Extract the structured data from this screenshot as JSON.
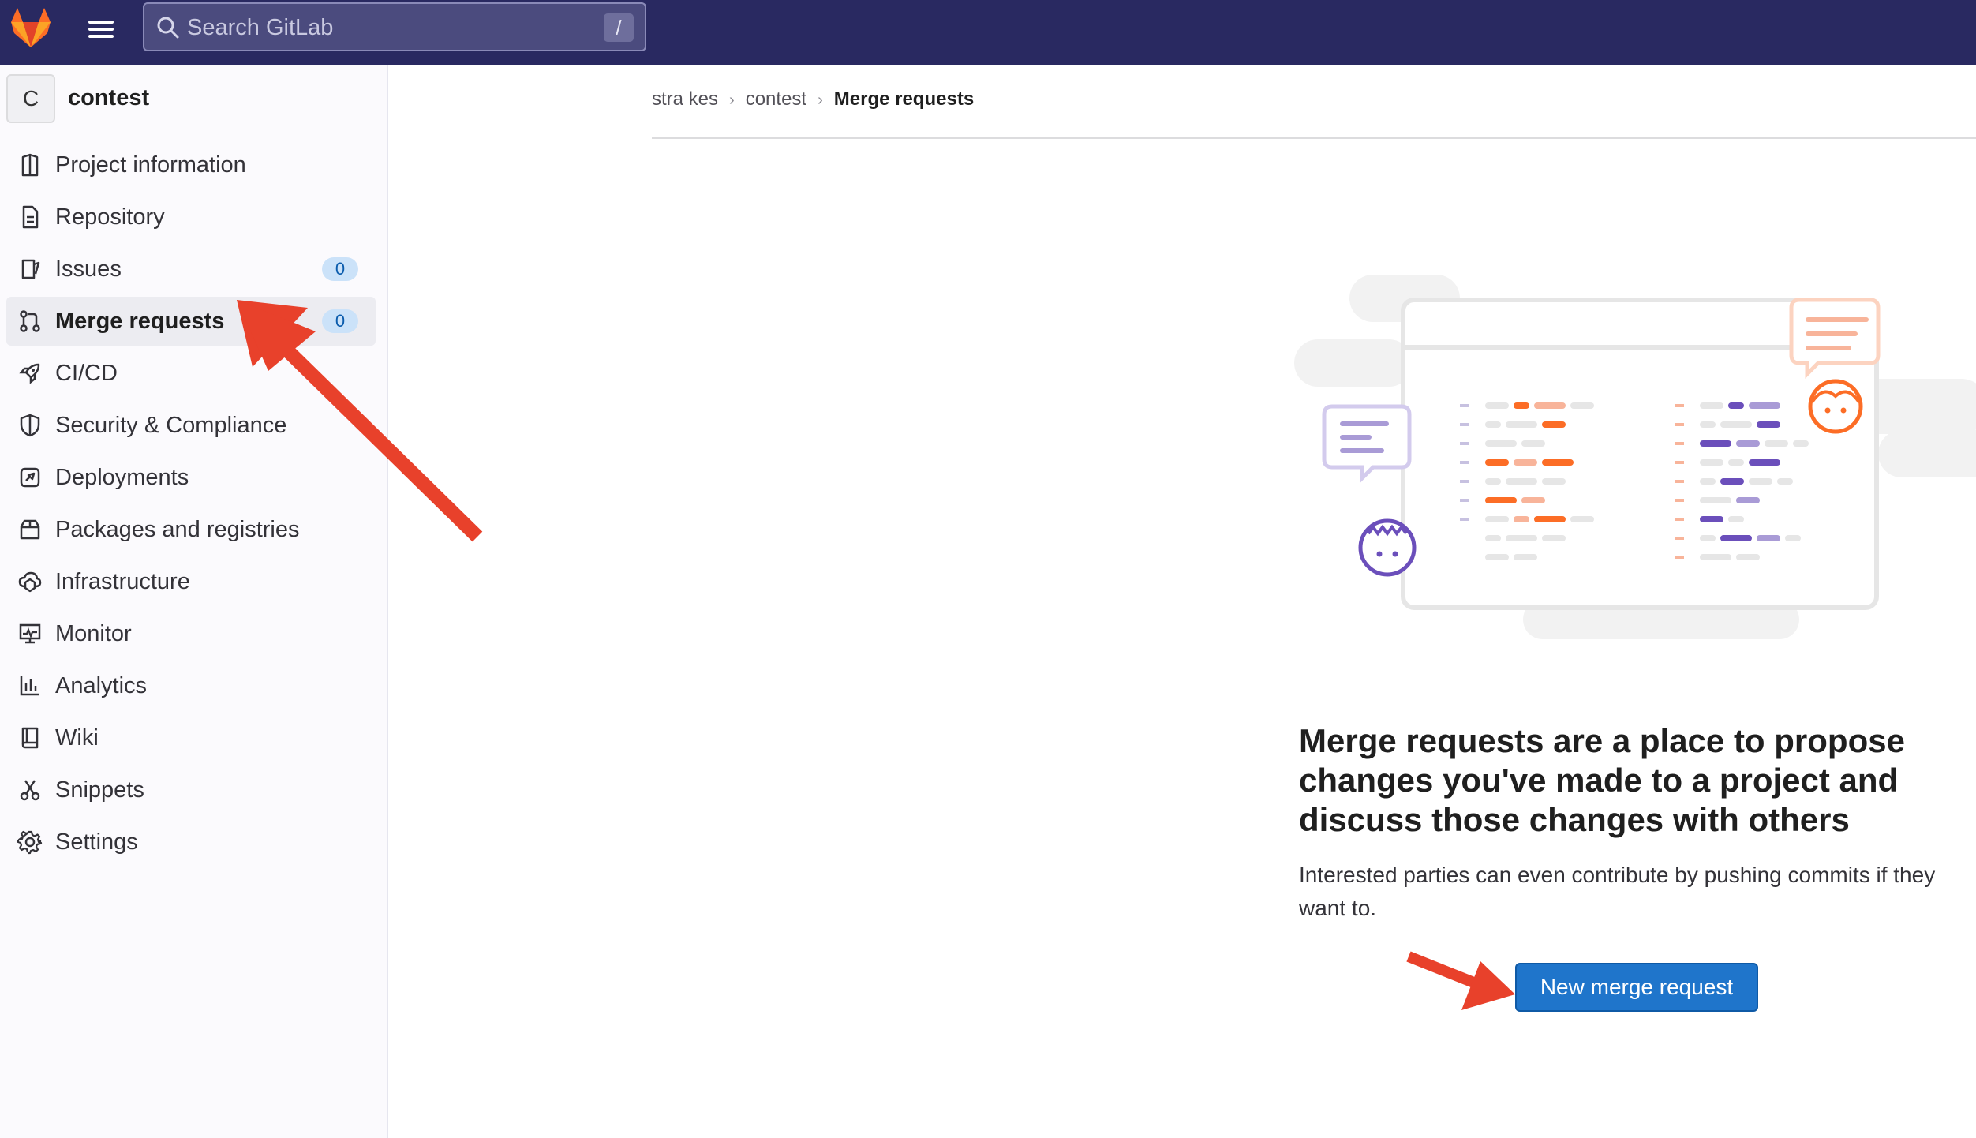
{
  "topbar": {
    "search_placeholder": "Search GitLab",
    "search_shortcut": "/",
    "colors": {
      "background": "#292961",
      "logo": "#e24329"
    }
  },
  "project": {
    "avatar_letter": "C",
    "name": "contest"
  },
  "sidebar": {
    "items": [
      {
        "label": "Project information",
        "icon": "project-information-icon"
      },
      {
        "label": "Repository",
        "icon": "repository-icon"
      },
      {
        "label": "Issues",
        "icon": "issues-icon",
        "badge": "0"
      },
      {
        "label": "Merge requests",
        "icon": "merge-request-icon",
        "badge": "0",
        "active": true
      },
      {
        "label": "CI/CD",
        "icon": "rocket-icon"
      },
      {
        "label": "Security & Compliance",
        "icon": "shield-icon"
      },
      {
        "label": "Deployments",
        "icon": "deployments-icon"
      },
      {
        "label": "Packages and registries",
        "icon": "package-icon"
      },
      {
        "label": "Infrastructure",
        "icon": "infrastructure-icon"
      },
      {
        "label": "Monitor",
        "icon": "monitor-icon"
      },
      {
        "label": "Analytics",
        "icon": "analytics-icon"
      },
      {
        "label": "Wiki",
        "icon": "book-icon"
      },
      {
        "label": "Snippets",
        "icon": "scissors-icon"
      },
      {
        "label": "Settings",
        "icon": "gear-icon"
      }
    ]
  },
  "breadcrumb": {
    "items": [
      "stra kes",
      "contest",
      "Merge requests"
    ]
  },
  "empty_state": {
    "title": "Merge requests are a place to propose changes you've made to a project and discuss those changes with others",
    "description": "Interested parties can even contribute by pushing commits if they want to.",
    "button_label": "New merge request"
  },
  "colors": {
    "primary_button": "#1f75cb",
    "badge_bg": "#cbe2f9",
    "annotation_arrow": "#e8412b"
  }
}
